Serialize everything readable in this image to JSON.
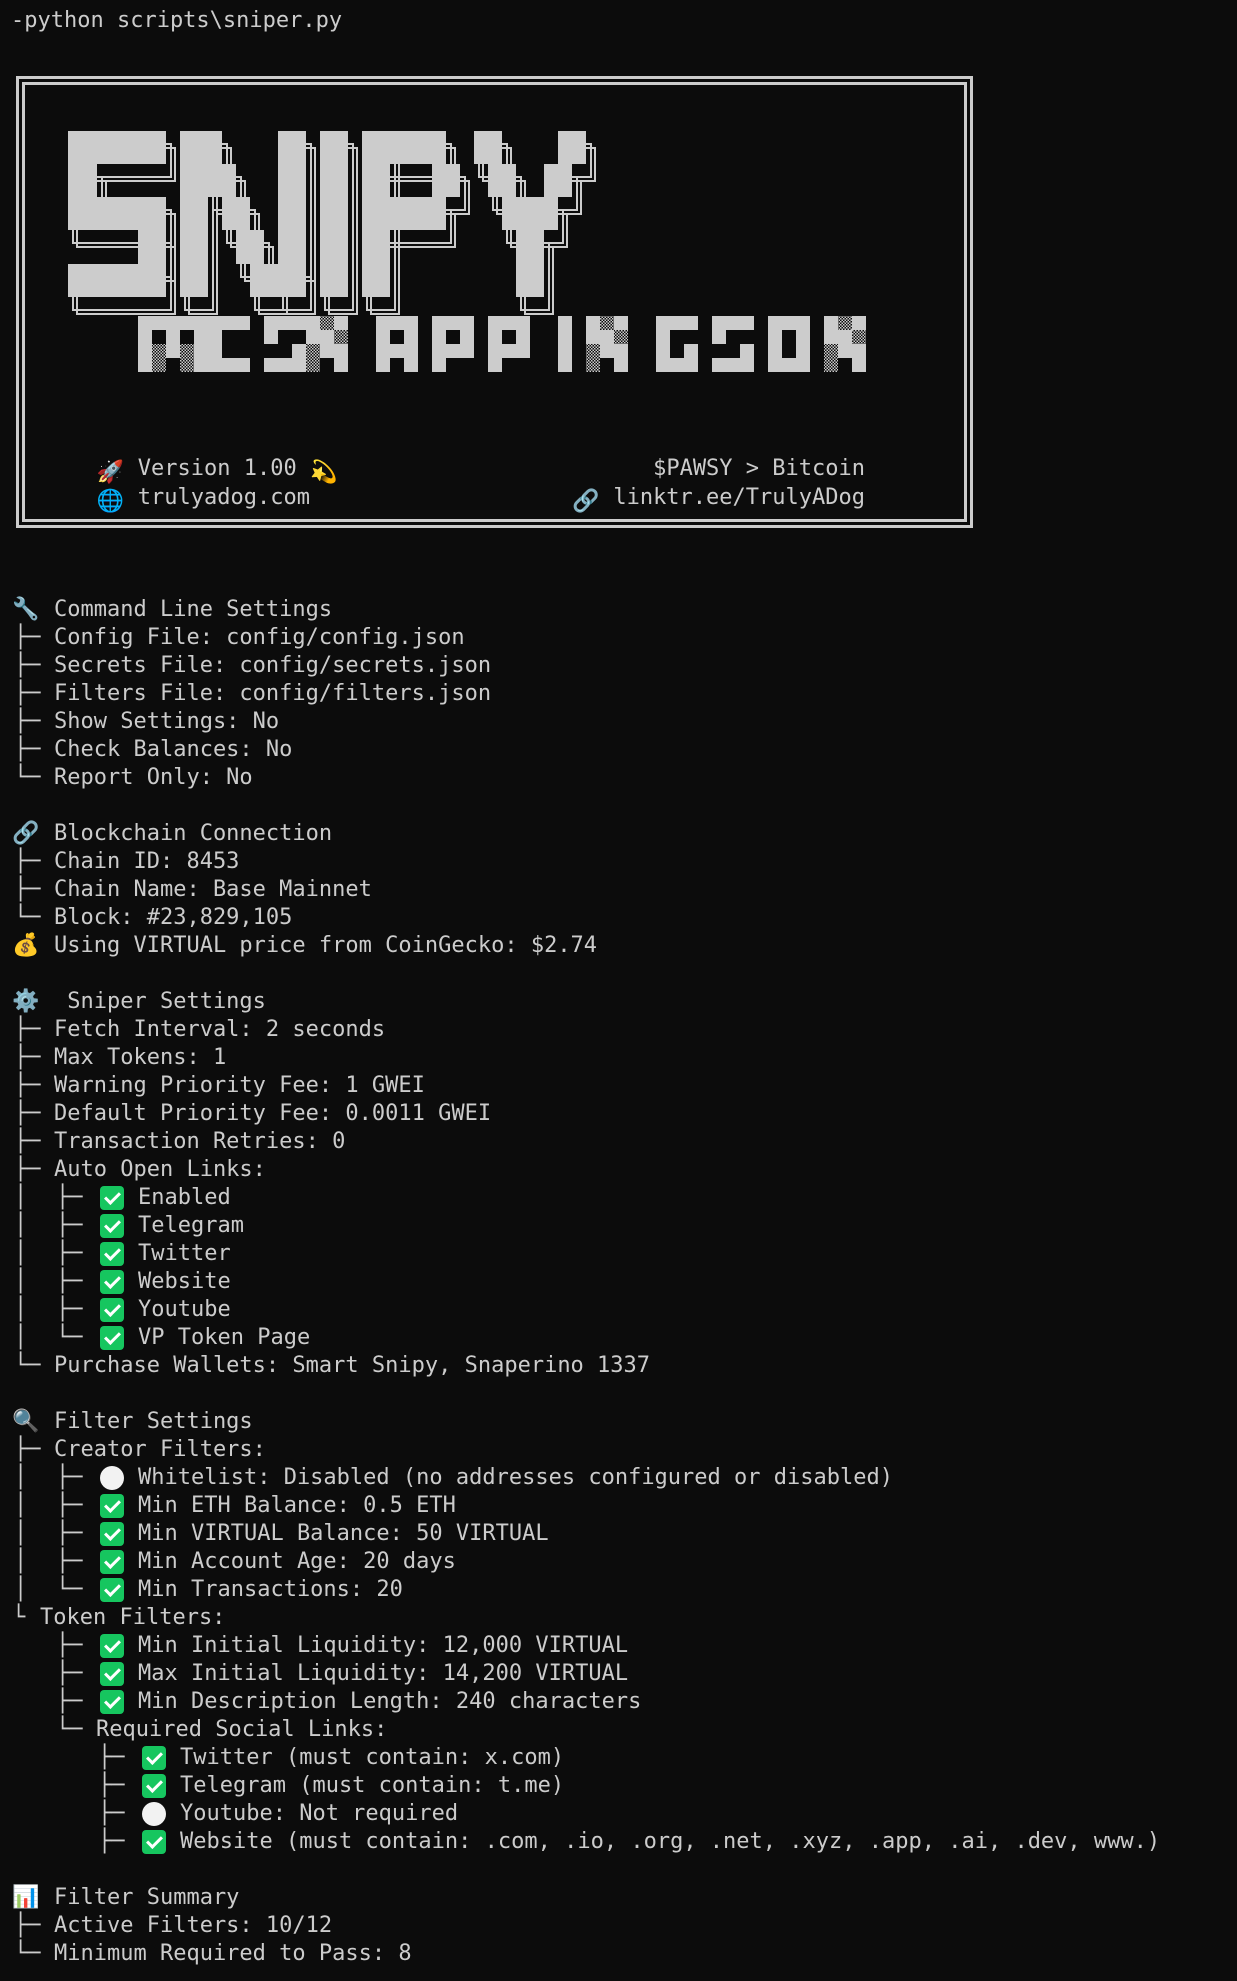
{
  "terminal": {
    "command": "-python scripts\\sniper.py"
  },
  "banner": {
    "title": "SNIPY",
    "subtitle": "MCSNAPPINGSON",
    "version": "Version 1.00",
    "website": "trulyadog.com",
    "tagline": "$PAWSY > Bitcoin",
    "link": "linktr.ee/TrulyADog",
    "icons": {
      "version_left": "rocket-icon",
      "version_right": "dizzy-icon",
      "website": "globe-icon",
      "link": "link-icon"
    }
  },
  "command_line_settings": {
    "heading": "Command Line Settings",
    "icon": "wrench-icon",
    "items": [
      "Config File: config/config.json",
      "Secrets File: config/secrets.json",
      "Filters File: config/filters.json",
      "Show Settings: No",
      "Check Balances: No",
      "Report Only: No"
    ]
  },
  "blockchain": {
    "heading": "Blockchain Connection",
    "icon": "link-icon",
    "items": [
      "Chain ID: 8453",
      "Chain Name: Base Mainnet",
      "Block: #23,829,105"
    ],
    "price_note": "Using VIRTUAL price from CoinGecko: $2.74",
    "price_icon": "money-bag-icon"
  },
  "sniper_settings": {
    "heading": " Sniper Settings",
    "icon": "gear-icon",
    "items": [
      "Fetch Interval: 2 seconds",
      "Max Tokens: 1",
      "Warning Priority Fee: 1 GWEI",
      "Default Priority Fee: 0.0011 GWEI",
      "Transaction Retries: 0",
      "Auto Open Links:"
    ],
    "auto_open_links": [
      {
        "label": "Enabled",
        "status": "check"
      },
      {
        "label": "Telegram",
        "status": "check"
      },
      {
        "label": "Twitter",
        "status": "check"
      },
      {
        "label": "Website",
        "status": "check"
      },
      {
        "label": "Youtube",
        "status": "check"
      },
      {
        "label": "VP Token Page",
        "status": "check"
      }
    ],
    "purchase_wallets": "Purchase Wallets: Smart Snipy, Snaperino 1337"
  },
  "filter_settings": {
    "heading": "Filter Settings",
    "icon": "magnifier-icon",
    "creator_filters_label": "Creator Filters:",
    "creator_filters": [
      {
        "label": "Whitelist: Disabled (no addresses configured or disabled)",
        "status": "circle"
      },
      {
        "label": "Min ETH Balance: 0.5 ETH",
        "status": "check"
      },
      {
        "label": "Min VIRTUAL Balance: 50 VIRTUAL",
        "status": "check"
      },
      {
        "label": "Min Account Age: 20 days",
        "status": "check"
      },
      {
        "label": "Min Transactions: 20",
        "status": "check"
      }
    ],
    "token_filters_label": "Token Filters:",
    "token_filters": [
      {
        "label": "Min Initial Liquidity: 12,000 VIRTUAL",
        "status": "check"
      },
      {
        "label": "Max Initial Liquidity: 14,200 VIRTUAL",
        "status": "check"
      },
      {
        "label": "Min Description Length: 240 characters",
        "status": "check"
      }
    ],
    "social_links_label": "Required Social Links:",
    "social_links": [
      {
        "label": "Twitter (must contain: x.com)",
        "status": "check"
      },
      {
        "label": "Telegram (must contain: t.me)",
        "status": "check"
      },
      {
        "label": "Youtube: Not required",
        "status": "circle"
      },
      {
        "label": "Website (must contain: .com, .io, .org, .net, .xyz, .app, .ai, .dev, www.)",
        "status": "check"
      }
    ]
  },
  "filter_summary": {
    "heading": "Filter Summary",
    "icon": "bar-chart-icon",
    "items": [
      "Active Filters: 10/12",
      "Minimum Required to Pass: 8"
    ]
  },
  "tree": {
    "branch": "├─",
    "last": "└─",
    "pipe": "│",
    "short_last": "└"
  },
  "colors": {
    "background": "#0c0c0c",
    "text": "#cccccc",
    "check": "#16c65f"
  }
}
